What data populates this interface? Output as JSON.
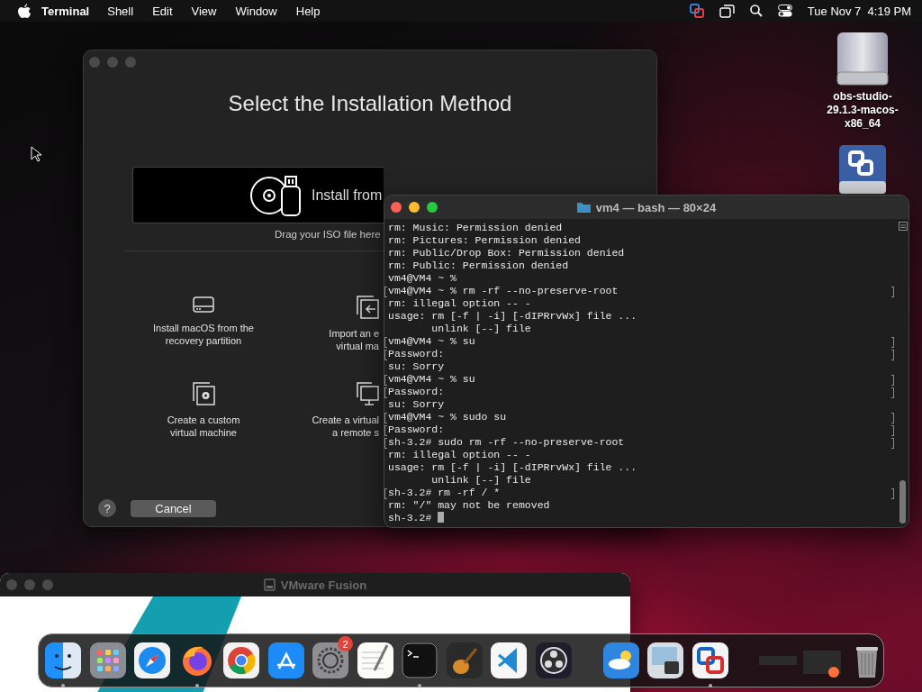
{
  "menu_bar": {
    "app_name": "Terminal",
    "menus": [
      "Shell",
      "Edit",
      "View",
      "Window",
      "Help"
    ],
    "clock": "Tue Nov 7  4:19 PM"
  },
  "desktop_icons": [
    {
      "kind": "drive",
      "label": "obs-studio-29.1.3-macos-x86_64"
    },
    {
      "kind": "vmware-drive"
    }
  ],
  "installer_window": {
    "active": false,
    "title": "Select the Installation Method",
    "install_box_label": "Install from",
    "drop_hint": "Drag your ISO file here",
    "options": [
      {
        "kind": "drive",
        "lines": [
          "Install macOS from the",
          "recovery partition"
        ]
      },
      {
        "kind": "import",
        "lines": [
          "Import an e",
          "virtual ma"
        ]
      },
      {
        "kind": "custom",
        "lines": [
          "Create a custom",
          "virtual machine"
        ]
      },
      {
        "kind": "remote",
        "lines": [
          "Create a virtual",
          "a remote s"
        ]
      }
    ],
    "help_button": "?",
    "cancel_button": "Cancel"
  },
  "terminal_window": {
    "active": true,
    "title": "vm4 — bash — 80×24",
    "cursor": true,
    "lines": [
      {
        "text": "rm: Music: Permission denied",
        "marked": false
      },
      {
        "text": "rm: Pictures: Permission denied",
        "marked": false
      },
      {
        "text": "rm: Public/Drop Box: Permission denied",
        "marked": false
      },
      {
        "text": "rm: Public: Permission denied",
        "marked": false
      },
      {
        "text": "vm4@VM4 ~ %",
        "marked": false
      },
      {
        "text": "vm4@VM4 ~ % rm -rf --no-preserve-root",
        "marked": true
      },
      {
        "text": "rm: illegal option -- -",
        "marked": false
      },
      {
        "text": "usage: rm [-f | -i] [-dIPRrvWx] file ...",
        "marked": false
      },
      {
        "text": "       unlink [--] file",
        "marked": false
      },
      {
        "text": "vm4@VM4 ~ % su",
        "marked": true
      },
      {
        "text": "Password:",
        "marked": true
      },
      {
        "text": "su: Sorry",
        "marked": false
      },
      {
        "text": "vm4@VM4 ~ % su",
        "marked": true
      },
      {
        "text": "Password:",
        "marked": true
      },
      {
        "text": "su: Sorry",
        "marked": false
      },
      {
        "text": "vm4@VM4 ~ % sudo su",
        "marked": true
      },
      {
        "text": "Password:",
        "marked": true
      },
      {
        "text": "sh-3.2# sudo rm -rf --no-preserve-root",
        "marked": true
      },
      {
        "text": "rm: illegal option -- -",
        "marked": false
      },
      {
        "text": "usage: rm [-f | -i] [-dIPRrvWx] file ...",
        "marked": false
      },
      {
        "text": "       unlink [--] file",
        "marked": false
      },
      {
        "text": "sh-3.2# rm -rf / *",
        "marked": true
      },
      {
        "text": "rm: \"/\" may not be removed",
        "marked": false
      },
      {
        "text": "sh-3.2#",
        "marked": false
      }
    ]
  },
  "vmware_window": {
    "active": false,
    "title": "VMware Fusion"
  },
  "dock": {
    "items": [
      {
        "kind": "finder",
        "running": true
      },
      {
        "kind": "launchpad",
        "running": false
      },
      {
        "kind": "safari",
        "running": false
      },
      {
        "kind": "firefox",
        "running": true
      },
      {
        "kind": "chrome",
        "running": false
      },
      {
        "kind": "appstore",
        "running": false
      },
      {
        "kind": "settings",
        "running": false,
        "badge": "2"
      },
      {
        "kind": "textedit",
        "running": false
      },
      {
        "kind": "terminal",
        "running": true
      },
      {
        "kind": "garageband",
        "running": false
      },
      {
        "kind": "vscode",
        "running": false
      },
      {
        "kind": "obs",
        "running": false
      },
      {
        "kind": "separator"
      },
      {
        "kind": "weather",
        "running": false
      },
      {
        "kind": "preview",
        "running": false
      },
      {
        "kind": "vmware",
        "running": true
      },
      {
        "kind": "separator"
      },
      {
        "kind": "window-thumb",
        "running": false
      },
      {
        "kind": "window-thumb-firefox",
        "running": false
      },
      {
        "kind": "trash",
        "running": false
      }
    ]
  }
}
